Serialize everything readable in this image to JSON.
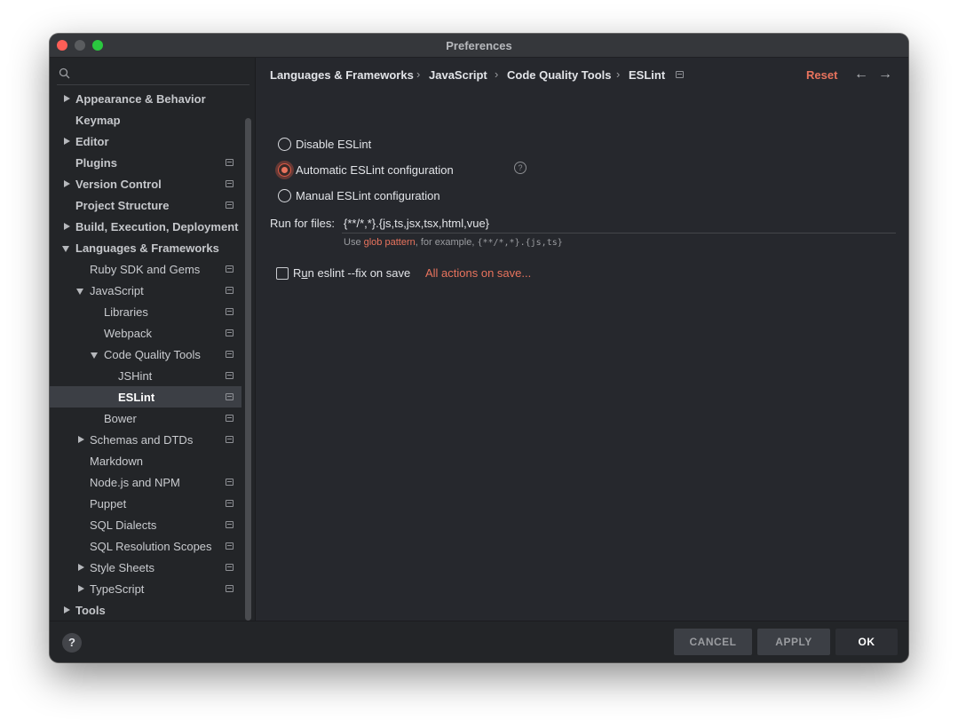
{
  "window": {
    "title": "Preferences"
  },
  "sidebar": {
    "search": {
      "placeholder": ""
    },
    "items": [
      {
        "label": "Appearance & Behavior",
        "bold": true,
        "arrow": "right",
        "indent": 0,
        "icon": false
      },
      {
        "label": "Keymap",
        "bold": true,
        "arrow": "",
        "indent": 0,
        "icon": false
      },
      {
        "label": "Editor",
        "bold": true,
        "arrow": "right",
        "indent": 0,
        "icon": false
      },
      {
        "label": "Plugins",
        "bold": true,
        "arrow": "",
        "indent": 0,
        "icon": true
      },
      {
        "label": "Version Control",
        "bold": true,
        "arrow": "right",
        "indent": 0,
        "icon": true
      },
      {
        "label": "Project Structure",
        "bold": true,
        "arrow": "",
        "indent": 0,
        "icon": true
      },
      {
        "label": "Build, Execution, Deployment",
        "bold": true,
        "arrow": "right",
        "indent": 0,
        "icon": false
      },
      {
        "label": "Languages & Frameworks",
        "bold": true,
        "arrow": "down",
        "indent": 0,
        "icon": false
      },
      {
        "label": "Ruby SDK and Gems",
        "bold": false,
        "arrow": "",
        "indent": 1,
        "icon": true
      },
      {
        "label": "JavaScript",
        "bold": false,
        "arrow": "down",
        "indent": 1,
        "icon": true
      },
      {
        "label": "Libraries",
        "bold": false,
        "arrow": "",
        "indent": 2,
        "icon": true
      },
      {
        "label": "Webpack",
        "bold": false,
        "arrow": "",
        "indent": 2,
        "icon": true
      },
      {
        "label": "Code Quality Tools",
        "bold": false,
        "arrow": "down",
        "indent": 2,
        "icon": true
      },
      {
        "label": "JSHint",
        "bold": false,
        "arrow": "",
        "indent": 3,
        "icon": true
      },
      {
        "label": "ESLint",
        "bold": false,
        "arrow": "",
        "indent": 3,
        "icon": true,
        "selected": true
      },
      {
        "label": "Bower",
        "bold": false,
        "arrow": "",
        "indent": 2,
        "icon": true
      },
      {
        "label": "Schemas and DTDs",
        "bold": false,
        "arrow": "right",
        "indent": 1,
        "icon": true
      },
      {
        "label": "Markdown",
        "bold": false,
        "arrow": "",
        "indent": 1,
        "icon": false
      },
      {
        "label": "Node.js and NPM",
        "bold": false,
        "arrow": "",
        "indent": 1,
        "icon": true
      },
      {
        "label": "Puppet",
        "bold": false,
        "arrow": "",
        "indent": 1,
        "icon": true
      },
      {
        "label": "SQL Dialects",
        "bold": false,
        "arrow": "",
        "indent": 1,
        "icon": true
      },
      {
        "label": "SQL Resolution Scopes",
        "bold": false,
        "arrow": "",
        "indent": 1,
        "icon": true
      },
      {
        "label": "Style Sheets",
        "bold": false,
        "arrow": "right",
        "indent": 1,
        "icon": true
      },
      {
        "label": "TypeScript",
        "bold": false,
        "arrow": "right",
        "indent": 1,
        "icon": true
      },
      {
        "label": "Tools",
        "bold": true,
        "arrow": "right",
        "indent": 0,
        "icon": false
      }
    ]
  },
  "breadcrumb": {
    "items": [
      "Languages & Frameworks",
      "JavaScript",
      "Code Quality Tools",
      "ESLint"
    ],
    "separator": "›",
    "reset": "Reset",
    "back": "←",
    "forward": "→"
  },
  "eslint": {
    "options": [
      {
        "label": "Disable ESLint",
        "checked": false
      },
      {
        "label": "Automatic ESLint configuration",
        "checked": true
      },
      {
        "label": "Manual ESLint configuration",
        "checked": false
      }
    ],
    "help": "?",
    "run_for_files_label": "Run for files:",
    "run_for_files_value": "{**/*,*}.{js,ts,jsx,tsx,html,vue}",
    "hint_prefix": "Use",
    "hint_link": "glob pattern",
    "hint_middle": ", for example,",
    "hint_example": "{**/*,*}.{js,ts}",
    "fix_on_save_pre": "R",
    "fix_on_save_underline": "u",
    "fix_on_save_post": "n eslint --fix on save",
    "fix_on_save_checked": false,
    "actions_link": "All actions on save..."
  },
  "footer": {
    "help": "?",
    "cancel": "CANCEL",
    "apply": "APPLY",
    "ok": "OK"
  },
  "colors": {
    "accent": "#e8735d",
    "background": "#26282d",
    "sidebar": "#232528"
  }
}
